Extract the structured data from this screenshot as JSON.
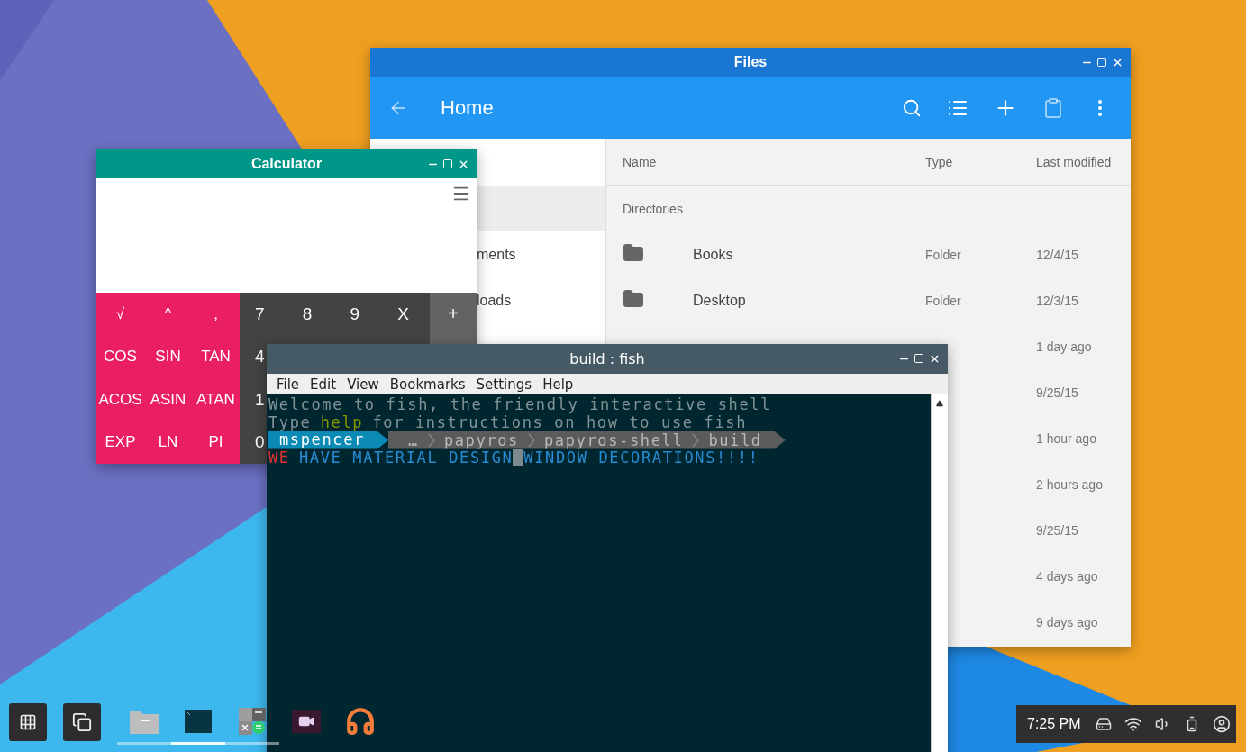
{
  "files": {
    "title": "Files",
    "heading": "Home",
    "sidebar": [
      {
        "selected": true
      },
      {
        "label": "ments",
        "selected": false
      },
      {
        "label": "loads",
        "selected": false
      }
    ],
    "columns": [
      "Name",
      "Type",
      "Last modified"
    ],
    "section": "Directories",
    "rows": [
      {
        "name": "Books",
        "type": "Folder",
        "modified": "12/4/15"
      },
      {
        "name": "Desktop",
        "type": "Folder",
        "modified": "12/3/15"
      },
      {
        "modified": "1 day ago"
      },
      {
        "modified": "9/25/15"
      },
      {
        "modified": "1 hour ago"
      },
      {
        "modified": "2 hours ago"
      },
      {
        "modified": "9/25/15"
      },
      {
        "modified": "4 days ago"
      },
      {
        "modified": "9 days ago"
      }
    ]
  },
  "calculator": {
    "title": "Calculator",
    "functions": [
      [
        "√",
        "^",
        ","
      ],
      [
        "COS",
        "SIN",
        "TAN"
      ],
      [
        "ACOS",
        "ASIN",
        "ATAN"
      ],
      [
        "EXP",
        "LN",
        "PI"
      ]
    ],
    "digits": [
      [
        "7",
        "8",
        "9",
        "X"
      ],
      [
        "4"
      ],
      [
        "1"
      ],
      [
        "0"
      ]
    ],
    "operators": [
      "+"
    ]
  },
  "terminal": {
    "title": "build : fish",
    "menu": [
      "File",
      "Edit",
      "View",
      "Bookmarks",
      "Settings",
      "Help"
    ],
    "lines": [
      {
        "segments": [
          {
            "text": "Welcome to fish, the friendly interactive shell",
            "color": "#839496"
          }
        ]
      },
      {
        "segments": [
          {
            "text": "Type",
            "color": "#839496"
          },
          {
            "text": "help",
            "color": "#859900"
          },
          {
            "text": "for instructions on how to use fish",
            "color": "#839496"
          }
        ]
      },
      {
        "prompt": {
          "user": "mspencer",
          "path": [
            "…",
            "papyros",
            "papyros-shell",
            "build"
          ]
        }
      },
      {
        "segments": [
          {
            "text": "WE",
            "color": "#dc322f"
          },
          {
            "text": "HAVE MATERIAL DESIGN",
            "color": "#268bd2"
          },
          {
            "kind": "cursor"
          },
          {
            "text": "WINDOW DECORATIONS!!!!",
            "color": "#268bd2"
          }
        ]
      }
    ]
  },
  "taskbar": {
    "apps": [
      {
        "kind": "files",
        "running": true,
        "selected": false
      },
      {
        "kind": "terminal",
        "running": true,
        "selected": true
      },
      {
        "kind": "calculator",
        "running": true,
        "selected": false
      },
      {
        "kind": "video",
        "running": false,
        "selected": false
      },
      {
        "kind": "music",
        "running": false,
        "selected": false
      }
    ],
    "time": "7:25 PM"
  }
}
